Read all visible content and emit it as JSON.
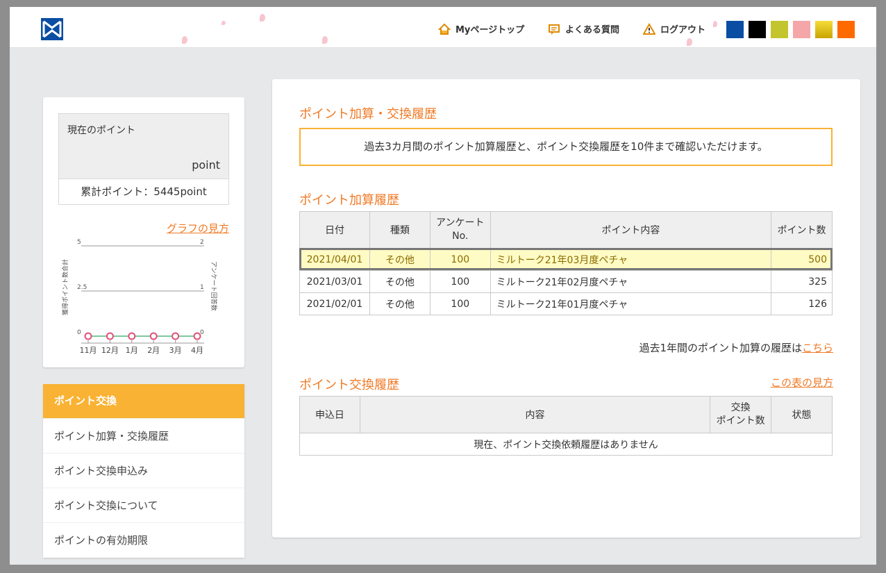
{
  "header": {
    "nav": [
      {
        "label": "Myページトップ",
        "icon": "home-icon"
      },
      {
        "label": "よくある質問",
        "icon": "faq-icon"
      },
      {
        "label": "ログアウト",
        "icon": "warning-icon"
      }
    ],
    "theme_colors": [
      "#0a4ea3",
      "#000000",
      "#c3c52e",
      "#f4a6a8",
      "#e8c400",
      "#ff6a00"
    ]
  },
  "sidebar": {
    "current_points_label": "現在のポイント",
    "points_unit": "point",
    "total_points": "累計ポイント：5445point",
    "graph_link": "グラフの見方",
    "chart_data": {
      "type": "line",
      "categories": [
        "11月",
        "12月",
        "1月",
        "2月",
        "3月",
        "4月"
      ],
      "series": [
        {
          "name": "獲得ポイント数合計",
          "values": [
            0,
            0,
            0,
            0,
            0,
            0
          ]
        }
      ],
      "ylabel": "獲得ポイント数合計",
      "y2label": "アンケート回答数",
      "ylim": [
        0,
        5
      ],
      "y_ticks": [
        "5",
        "2.5",
        "0"
      ],
      "y2lim": [
        0,
        2
      ],
      "y2_ticks": [
        "2",
        "1",
        "0"
      ]
    },
    "menu_head": "ポイント交換",
    "menu": [
      "ポイント加算・交換履歴",
      "ポイント交換申込み",
      "ポイント交換について",
      "ポイントの有効期限"
    ]
  },
  "main": {
    "title": "ポイント加算・交換履歴",
    "notice": "過去3カ月間のポイント加算履歴と、ポイント交換履歴を10件まで確認いただけます。",
    "add_history": {
      "title": "ポイント加算履歴",
      "headers": [
        "日付",
        "種類",
        "アンケート\nNo.",
        "ポイント内容",
        "ポイント数"
      ],
      "rows": [
        [
          "2021/04/01",
          "その他",
          "100",
          "ミルトーク21年03月度ペチャ",
          "500"
        ],
        [
          "2021/03/01",
          "その他",
          "100",
          "ミルトーク21年02月度ペチャ",
          "325"
        ],
        [
          "2021/02/01",
          "その他",
          "100",
          "ミルトーク21年01月度ペチャ",
          "126"
        ]
      ]
    },
    "more_text": "過去1年間のポイント加算の履歴は",
    "more_link": "こちら",
    "exchange_history": {
      "title": "ポイント交換履歴",
      "table_link": "この表の見方",
      "headers": [
        "申込日",
        "内容",
        "交換\nポイント数",
        "状態"
      ],
      "empty": "現在、ポイント交換依頼履歴はありません"
    }
  }
}
